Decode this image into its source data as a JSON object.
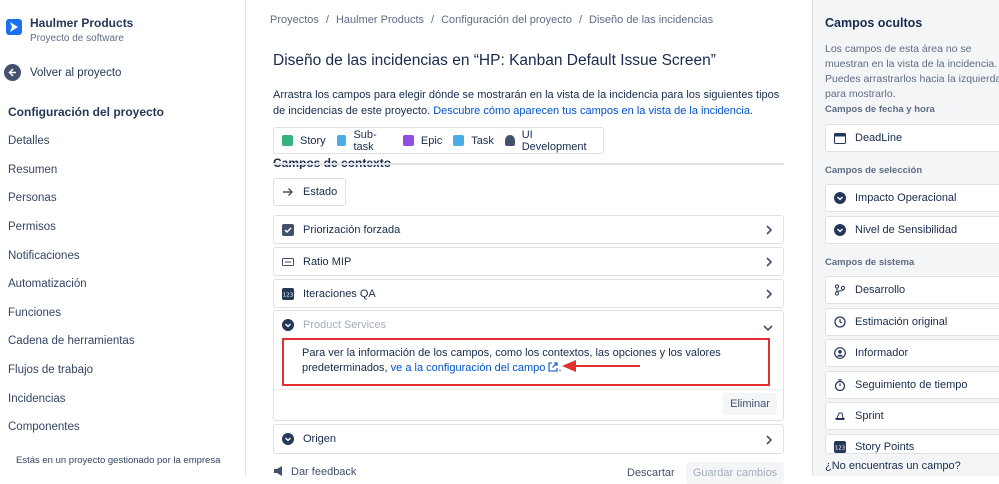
{
  "project": {
    "name": "Haulmer Products",
    "type": "Proyecto de software"
  },
  "back_label": "Volver al proyecto",
  "nav": {
    "section_title": "Configuración del proyecto",
    "items": [
      "Detalles",
      "Resumen",
      "Personas",
      "Permisos",
      "Notificaciones",
      "Automatización",
      "Funciones",
      "Cadena de herramientas",
      "Flujos de trabajo",
      "Incidencias",
      "Componentes"
    ],
    "footer": "Estás en un proyecto gestionado por la empresa"
  },
  "breadcrumbs": [
    "Proyectos",
    "Haulmer Products",
    "Configuración del proyecto",
    "Diseño de las incidencias"
  ],
  "page_title": "Diseño de las incidencias en “HP: Kanban Default Issue Screen”",
  "description": {
    "text": "Arrastra los campos para elegir dónde se mostrarán en la vista de la incidencia para los siguientes tipos de incidencias de este proyecto.",
    "link": "Descubre cómo aparecen tus campos en la vista de la incidencia."
  },
  "issue_types": [
    {
      "label": "Story",
      "color": "#36b37e"
    },
    {
      "label": "Sub-task",
      "color": "#4bade8"
    },
    {
      "label": "Epic",
      "color": "#904ee2"
    },
    {
      "label": "Task",
      "color": "#4bade8"
    },
    {
      "label": "UI Development",
      "color": "#42526e"
    }
  ],
  "context_title": "Campos de contexto",
  "estado_label": "Estado",
  "fields": [
    {
      "label": "Priorización forzada"
    },
    {
      "label": "Ratio MIP"
    },
    {
      "label": "Iteraciones QA"
    }
  ],
  "expanded_field": {
    "label": "Product Services",
    "info_text": "Para ver la información de los campos, como los contextos, las opciones y los valores predeterminados,",
    "info_link": "ve a la configuración del campo",
    "info_end": ".",
    "remove_label": "Eliminar"
  },
  "origen_label": "Origen",
  "bottom": {
    "feedback": "Dar feedback",
    "discard": "Descartar",
    "save": "Guardar cambios"
  },
  "hidden": {
    "title": "Campos ocultos",
    "description": "Los campos de esta área no se muestran en la vista de la incidencia. Puedes arrastrarlos hacia la izquierda para mostrarlo.",
    "categories": [
      {
        "title": "Campos de fecha y hora",
        "items": [
          "DeadLine"
        ]
      },
      {
        "title": "Campos de selección",
        "items": [
          "Impacto Operacional",
          "Nivel de Sensibilidad"
        ]
      },
      {
        "title": "Campos de sistema",
        "items": [
          "Desarrollo",
          "Estimación original",
          "Informador",
          "Seguimiento de tiempo",
          "Sprint",
          "Story Points"
        ]
      }
    ],
    "footer": "¿No encuentras un campo?"
  }
}
